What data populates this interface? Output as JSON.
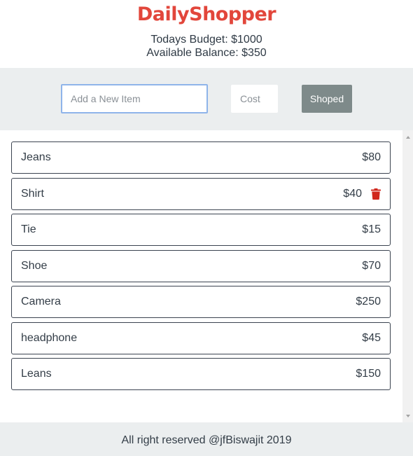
{
  "header": {
    "brand": "DailyShopper",
    "budget_text": "Todays Budget: $1000",
    "balance_text": "Available Balance: $350"
  },
  "form": {
    "item_placeholder": "Add a New Item",
    "cost_placeholder": "Cost",
    "submit_label": "Shoped"
  },
  "items": [
    {
      "name": "Jeans",
      "cost": "$80"
    },
    {
      "name": "Shirt",
      "cost": "$40"
    },
    {
      "name": "Tie",
      "cost": "$15"
    },
    {
      "name": "Shoe",
      "cost": "$70"
    },
    {
      "name": "Camera",
      "cost": "$250"
    },
    {
      "name": "headphone",
      "cost": "$45"
    },
    {
      "name": "Leans",
      "cost": "$150"
    }
  ],
  "footer": {
    "text": "All right reserved @jfBiswajit 2019"
  },
  "icons": {
    "delete": "trash-icon"
  },
  "colors": {
    "brand": "#e2463b",
    "delete": "#d0271d",
    "button": "#7e8a8a",
    "bar": "#ebeeef"
  }
}
